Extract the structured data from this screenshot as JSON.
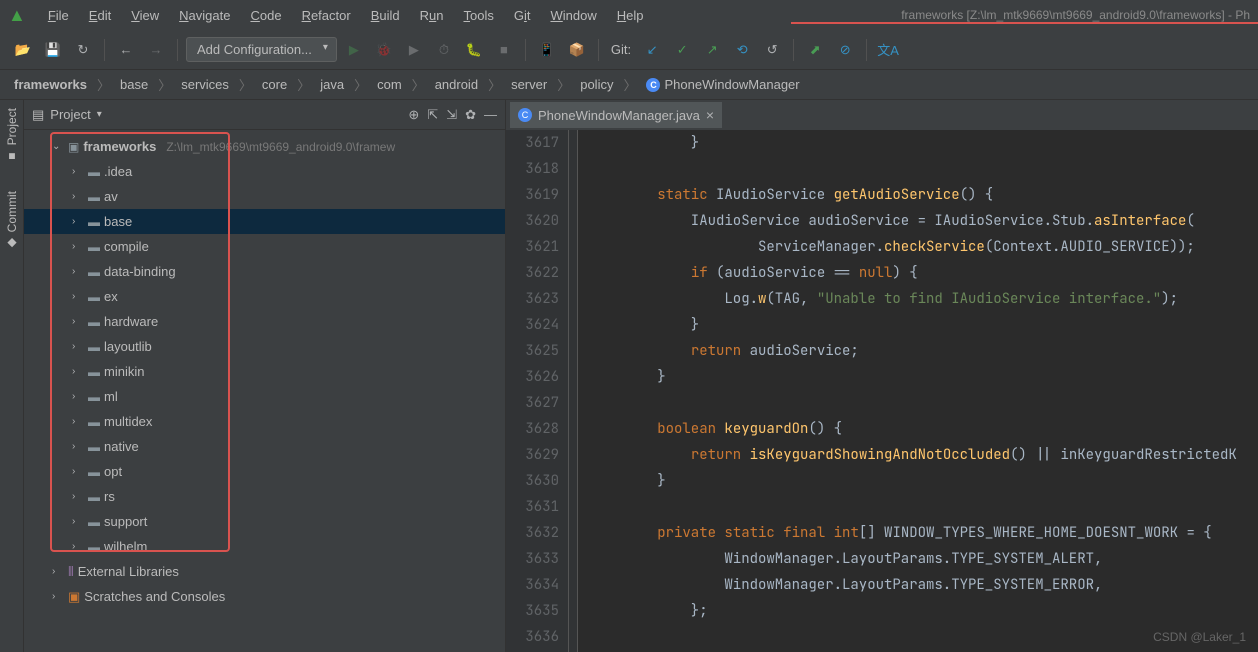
{
  "title": "frameworks [Z:\\lm_mtk9669\\mt9669_android9.0\\frameworks] - Ph",
  "menu": {
    "file": "File",
    "edit": "Edit",
    "view": "View",
    "navigate": "Navigate",
    "code": "Code",
    "refactor": "Refactor",
    "build": "Build",
    "run": "Run",
    "tools": "Tools",
    "git": "Git",
    "window": "Window",
    "help": "Help"
  },
  "toolbar": {
    "config": "Add Configuration...",
    "git_label": "Git:"
  },
  "breadcrumb": {
    "items": [
      "frameworks",
      "base",
      "services",
      "core",
      "java",
      "com",
      "android",
      "server",
      "policy",
      "PhoneWindowManager"
    ]
  },
  "panel": {
    "title": "Project",
    "root_label": "frameworks",
    "root_path": "Z:\\lm_mtk9669\\mt9669_android9.0\\framew",
    "folders": [
      ".idea",
      "av",
      "base",
      "compile",
      "data-binding",
      "ex",
      "hardware",
      "layoutlib",
      "minikin",
      "ml",
      "multidex",
      "native",
      "opt",
      "rs",
      "support",
      "wilhelm"
    ],
    "external_libs": "External Libraries",
    "scratches": "Scratches and Consoles"
  },
  "left_tabs": {
    "project": "Project",
    "commit": "Commit"
  },
  "editor": {
    "tab_name": "PhoneWindowManager.java",
    "lines_start": 3617,
    "lines": [
      "            }",
      "",
      "        static IAudioService getAudioService() {",
      "            IAudioService audioService = IAudioService.Stub.asInterface(",
      "                    ServiceManager.checkService(Context.AUDIO_SERVICE));",
      "            if (audioService == null) {",
      "                Log.w(TAG, \"Unable to find IAudioService interface.\");",
      "            }",
      "            return audioService;",
      "        }",
      "",
      "        boolean keyguardOn() {",
      "            return isKeyguardShowingAndNotOccluded() || inKeyguardRestrictedK",
      "        }",
      "",
      "        private static final int[] WINDOW_TYPES_WHERE_HOME_DOESNT_WORK = {",
      "                WindowManager.LayoutParams.TYPE_SYSTEM_ALERT,",
      "                WindowManager.LayoutParams.TYPE_SYSTEM_ERROR,",
      "            };",
      ""
    ]
  },
  "watermark": "CSDN @Laker_1"
}
